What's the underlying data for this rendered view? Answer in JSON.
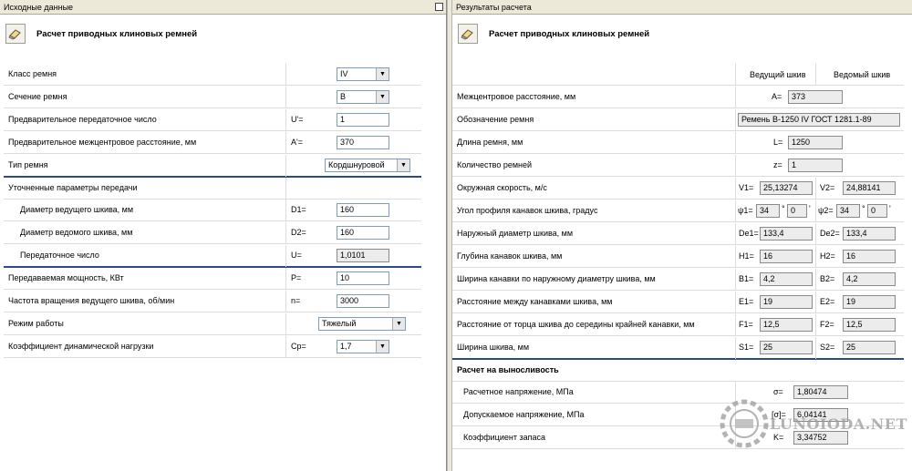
{
  "left": {
    "header": "Исходные данные",
    "title": "Расчет приводных клиновых ремней",
    "rows": [
      {
        "label": "Класс ремня",
        "type": "combo",
        "value": "IV"
      },
      {
        "label": "Сечение ремня",
        "type": "combo",
        "value": "B"
      },
      {
        "label": "Предварительное передаточное число",
        "symbol": "U'=",
        "type": "field",
        "value": "1"
      },
      {
        "label": "Предварительное межцентровое расстояние, мм",
        "symbol": "A'=",
        "type": "field",
        "value": "370"
      },
      {
        "label": "Тип ремня",
        "type": "combo",
        "value": "Кордшнуровой"
      },
      {
        "label": "Уточненные параметры передачи"
      },
      {
        "label": "Диаметр ведущего шкива, мм",
        "symbol": "D1=",
        "type": "field",
        "value": "160"
      },
      {
        "label": "Диаметр ведомого шкива, мм",
        "symbol": "D2=",
        "type": "field",
        "value": "160"
      },
      {
        "label": "Передаточное число",
        "symbol": "U=",
        "type": "field",
        "value": "1,0101"
      },
      {
        "label": "Передаваемая мощность, КВт",
        "symbol": "P=",
        "type": "field",
        "value": "10"
      },
      {
        "label": "Частота вращения ведущего шкива, об/мин",
        "symbol": "n=",
        "type": "field",
        "value": "3000"
      },
      {
        "label": "Режим работы",
        "type": "combo",
        "value": "Тяжелый"
      },
      {
        "label": "Коэффициент динамической нагрузки",
        "symbol": "Cp=",
        "type": "combo",
        "value": "1,7"
      }
    ]
  },
  "right": {
    "header": "Результаты расчета",
    "title": "Расчет приводных клиновых ремней",
    "col_driving": "Ведущий шкив",
    "col_driven": "Ведомый шкив",
    "center_distance": {
      "label": "Межцентровое расстояние, мм",
      "symbol": "A=",
      "value": "373"
    },
    "designation": {
      "label": "Обозначение ремня",
      "value": "Ремень B-1250 IV ГОСТ 1281.1-89"
    },
    "belt_length": {
      "label": "Длина ремня, мм",
      "symbol": "L=",
      "value": "1250"
    },
    "belt_count": {
      "label": "Количество ремней",
      "symbol": "z=",
      "value": "1"
    },
    "velocity": {
      "label": "Окружная скорость, м/с",
      "s1": "V1=",
      "v1": "25,13274",
      "s2": "V2=",
      "v2": "24,88141"
    },
    "angle": {
      "label": "Угол профиля канавок шкива, градус",
      "s1": "ψ1=",
      "d1": "34",
      "m1": "0",
      "s2": "ψ2=",
      "d2": "34",
      "m2": "0",
      "deg": "°",
      "min": "'"
    },
    "outer_diam": {
      "label": "Наружный диаметр шкива, мм",
      "s1": "De1=",
      "v1": "133,4",
      "s2": "De2=",
      "v2": "133,4"
    },
    "groove_depth": {
      "label": "Глубина канавок шкива, мм",
      "s1": "H1=",
      "v1": "16",
      "s2": "H2=",
      "v2": "16"
    },
    "groove_width": {
      "label": "Ширина канавки по наружному диаметру шкива, мм",
      "s1": "B1=",
      "v1": "4,2",
      "s2": "B2=",
      "v2": "4,2"
    },
    "groove_spacing": {
      "label": "Расстояние между канавками шкива, мм",
      "s1": "E1=",
      "v1": "19",
      "s2": "E2=",
      "v2": "19"
    },
    "edge_distance": {
      "label": "Расстояние от торца шкива до середины крайней канавки, мм",
      "s1": "F1=",
      "v1": "12,5",
      "s2": "F2=",
      "v2": "12,5"
    },
    "pulley_width": {
      "label": "Ширина шкива, мм",
      "s1": "S1=",
      "v1": "25",
      "s2": "S2=",
      "v2": "25"
    },
    "endurance_title": "Расчет на выносливость",
    "stress": {
      "label": "Расчетное напряжение, МПа",
      "symbol": "σ=",
      "value": "1,80474"
    },
    "allowed_stress": {
      "label": "Допускаемое напряжение, МПа",
      "symbol": "[σ]=",
      "value": "6,04141"
    },
    "safety": {
      "label": "Коэффициент запаса",
      "symbol": "K=",
      "value": "3,34752"
    }
  },
  "watermark": "LUNOIODA.NET",
  "icons": {
    "title_icon": "eraser-icon",
    "restore": "restore-icon"
  }
}
